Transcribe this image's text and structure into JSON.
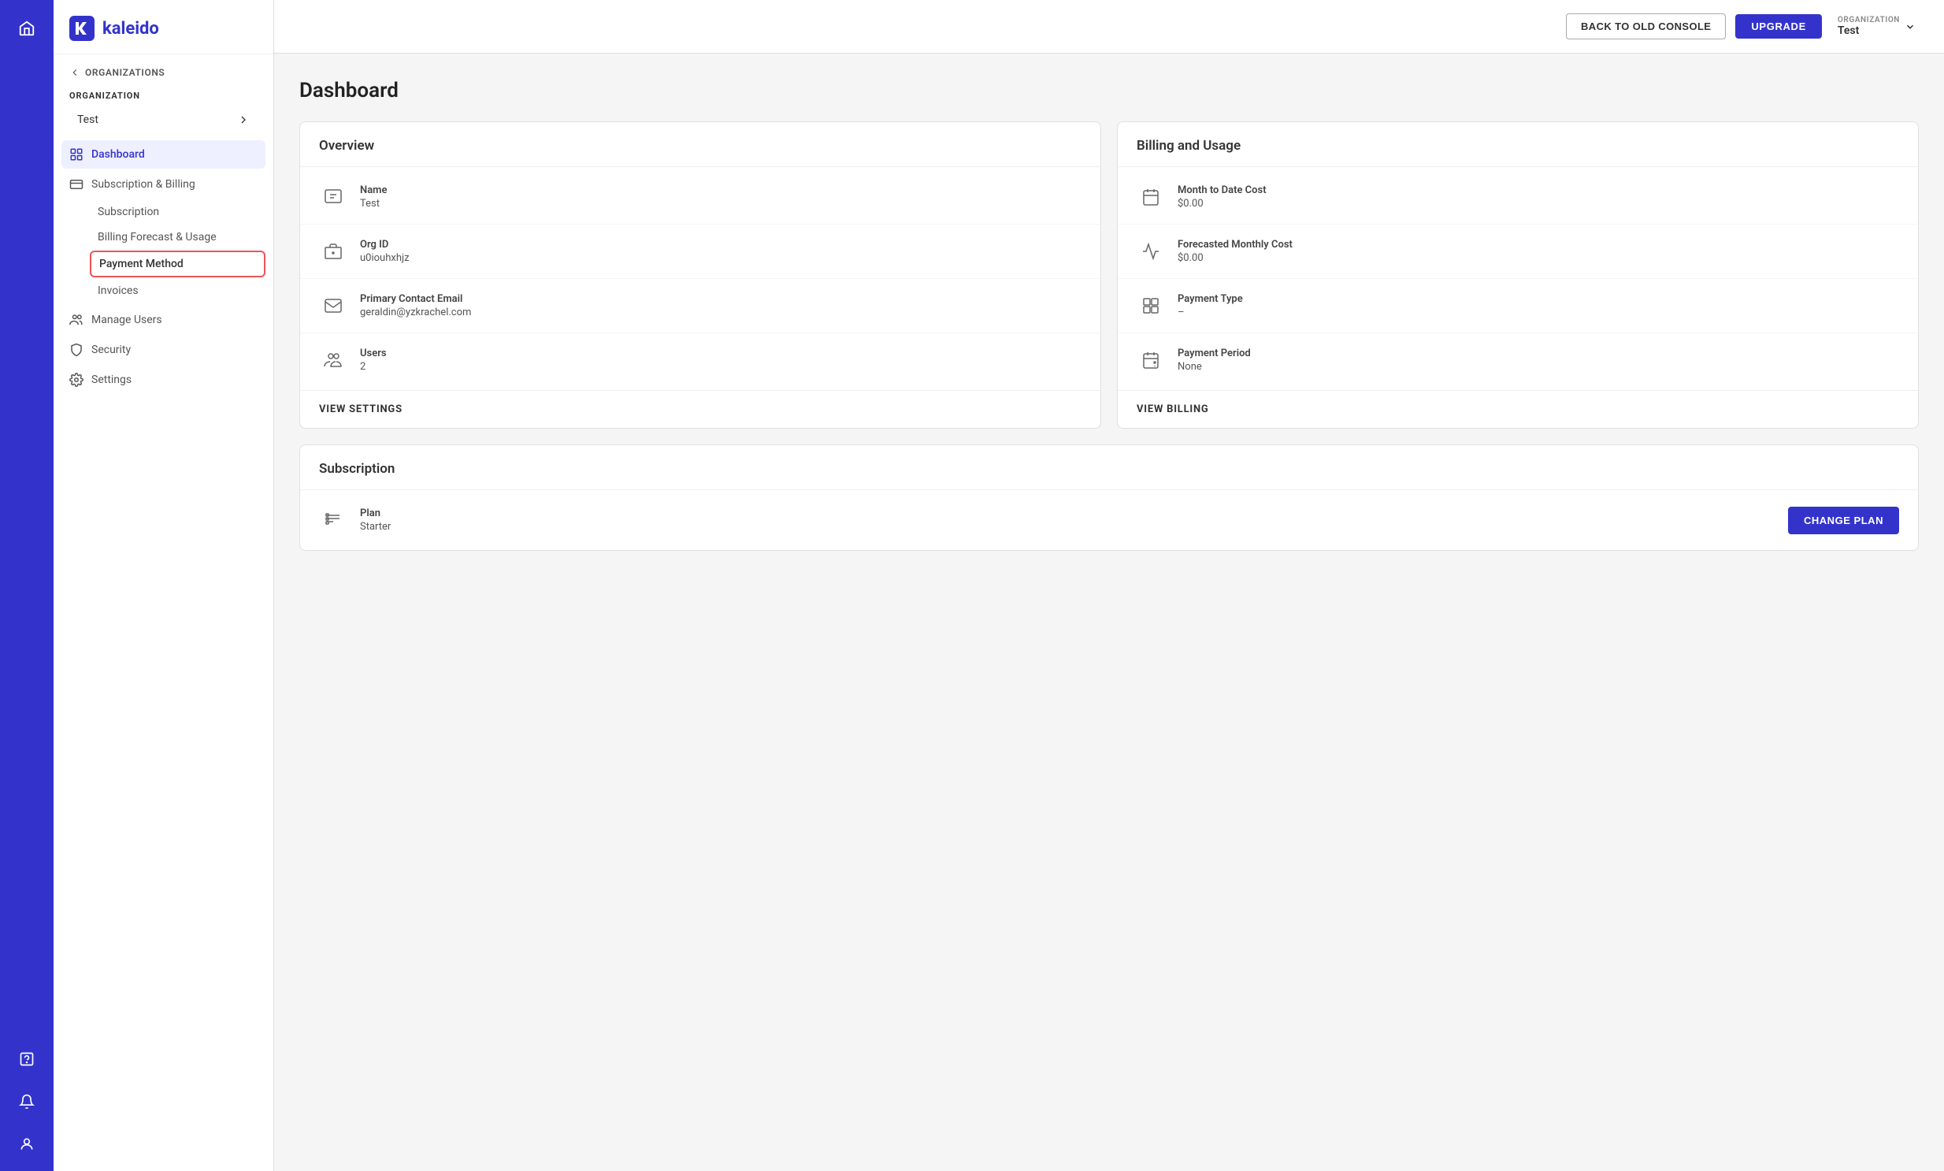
{
  "iconBar": {
    "homeLabel": "home"
  },
  "sidebar": {
    "logoText": "kaleido",
    "backLink": "ORGANIZATIONS",
    "sectionLabel": "ORGANIZATION",
    "orgName": "Test",
    "navItems": [
      {
        "id": "dashboard",
        "label": "Dashboard",
        "active": true
      },
      {
        "id": "subscription-billing",
        "label": "Subscription & Billing",
        "active": false
      }
    ],
    "subItems": [
      {
        "id": "subscription",
        "label": "Subscription",
        "active": false
      },
      {
        "id": "billing-forecast",
        "label": "Billing Forecast & Usage",
        "active": false
      },
      {
        "id": "payment-method",
        "label": "Payment Method",
        "active": true
      },
      {
        "id": "invoices",
        "label": "Invoices",
        "active": false
      }
    ],
    "bottomNav": [
      {
        "id": "manage-users",
        "label": "Manage Users"
      },
      {
        "id": "security",
        "label": "Security"
      },
      {
        "id": "settings",
        "label": "Settings"
      }
    ]
  },
  "topBar": {
    "backConsoleLabel": "BACK TO OLD CONSOLE",
    "upgradeLabel": "UPGRADE",
    "orgSelectorLabel": "ORGANIZATION",
    "orgSelectorName": "Test"
  },
  "dashboard": {
    "title": "Dashboard",
    "overviewCard": {
      "header": "Overview",
      "rows": [
        {
          "label": "Name",
          "value": "Test"
        },
        {
          "label": "Org ID",
          "value": "u0iouhxhjz"
        },
        {
          "label": "Primary Contact Email",
          "value": "geraldin@yzkrachel.com"
        },
        {
          "label": "Users",
          "value": "2"
        }
      ],
      "footer": "VIEW SETTINGS"
    },
    "billingCard": {
      "header": "Billing and Usage",
      "rows": [
        {
          "label": "Month to Date Cost",
          "value": "$0.00"
        },
        {
          "label": "Forecasted Monthly Cost",
          "value": "$0.00"
        },
        {
          "label": "Payment Type",
          "value": "–"
        },
        {
          "label": "Payment Period",
          "value": "None"
        }
      ],
      "footer": "VIEW BILLING"
    },
    "subscriptionCard": {
      "header": "Subscription",
      "planLabel": "Plan",
      "planValue": "Starter",
      "changePlanLabel": "CHANGE PLAN"
    }
  }
}
